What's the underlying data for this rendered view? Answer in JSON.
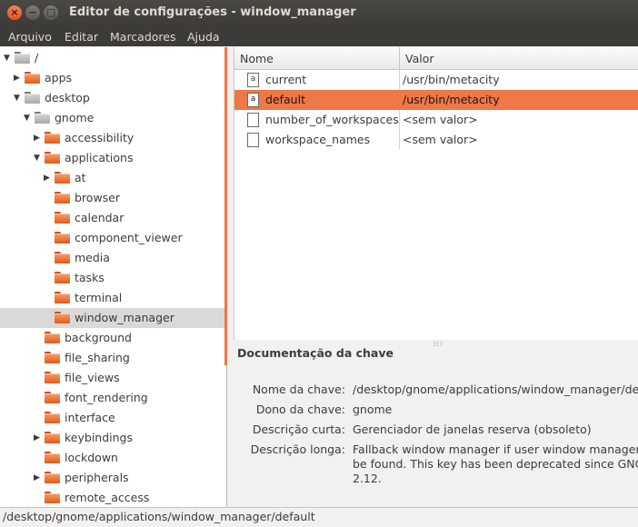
{
  "window": {
    "title": "Editor de configurações - window_manager",
    "close_glyph": "×",
    "minimize_glyph": "−",
    "maximize_glyph": "□"
  },
  "menubar": {
    "items": [
      "Arquivo",
      "Editar",
      "Marcadores",
      "Ajuda"
    ]
  },
  "tree": {
    "rows": [
      {
        "label": "/",
        "expander": "▼",
        "icon": "folder-grey-icon"
      },
      {
        "label": "apps",
        "expander": "▶",
        "icon": "folder-icon"
      },
      {
        "label": "desktop",
        "expander": "▼",
        "icon": "folder-grey-icon"
      },
      {
        "label": "gnome",
        "expander": "▼",
        "icon": "folder-grey-icon"
      },
      {
        "label": "accessibility",
        "expander": "▶",
        "icon": "folder-icon"
      },
      {
        "label": "applications",
        "expander": "▼",
        "icon": "folder-icon"
      },
      {
        "label": "at",
        "expander": "▶",
        "icon": "folder-icon"
      },
      {
        "label": "browser",
        "expander": "",
        "icon": "folder-icon"
      },
      {
        "label": "calendar",
        "expander": "",
        "icon": "folder-icon"
      },
      {
        "label": "component_viewer",
        "expander": "",
        "icon": "folder-icon"
      },
      {
        "label": "media",
        "expander": "",
        "icon": "folder-icon"
      },
      {
        "label": "tasks",
        "expander": "",
        "icon": "folder-icon"
      },
      {
        "label": "terminal",
        "expander": "",
        "icon": "folder-icon"
      },
      {
        "label": "window_manager",
        "expander": "",
        "icon": "folder-icon",
        "selected": true
      },
      {
        "label": "background",
        "expander": "",
        "icon": "folder-icon"
      },
      {
        "label": "file_sharing",
        "expander": "",
        "icon": "folder-icon"
      },
      {
        "label": "file_views",
        "expander": "",
        "icon": "folder-icon"
      },
      {
        "label": "font_rendering",
        "expander": "",
        "icon": "folder-icon"
      },
      {
        "label": "interface",
        "expander": "",
        "icon": "folder-icon"
      },
      {
        "label": "keybindings",
        "expander": "▶",
        "icon": "folder-icon"
      },
      {
        "label": "lockdown",
        "expander": "",
        "icon": "folder-icon"
      },
      {
        "label": "peripherals",
        "expander": "▶",
        "icon": "folder-icon"
      },
      {
        "label": "remote_access",
        "expander": "",
        "icon": "folder-icon"
      }
    ]
  },
  "list": {
    "header_name": "Nome",
    "header_value": "Valor",
    "rows": [
      {
        "icon": "text-key-icon",
        "icon_glyph": "a",
        "name": "current",
        "value": "/usr/bin/metacity"
      },
      {
        "icon": "text-key-icon",
        "icon_glyph": "a",
        "name": "default",
        "value": "/usr/bin/metacity",
        "selected": true
      },
      {
        "icon": "document-icon",
        "icon_glyph": "",
        "name": "number_of_workspaces",
        "value": "<sem valor>"
      },
      {
        "icon": "document-icon",
        "icon_glyph": "",
        "name": "workspace_names",
        "value": "<sem valor>"
      }
    ]
  },
  "documentation": {
    "title": "Documentação da chave",
    "grip": "⁞⁞⁞",
    "key_name_label": "Nome da chave:",
    "key_name_value": "/desktop/gnome/applications/window_manager/default",
    "owner_label": "Dono da chave:",
    "owner_value": "gnome",
    "short_desc_label": "Descrição curta:",
    "short_desc_value": "Gerenciador de janelas reserva (obsoleto)",
    "long_desc_label": "Descrição longa:",
    "long_desc_lines": [
      "Fallback window manager if user window manager cannot",
      "be found. This key has been deprecated since GNOME",
      "2.12."
    ]
  },
  "statusbar": {
    "path": "/desktop/gnome/applications/window_manager/default"
  }
}
